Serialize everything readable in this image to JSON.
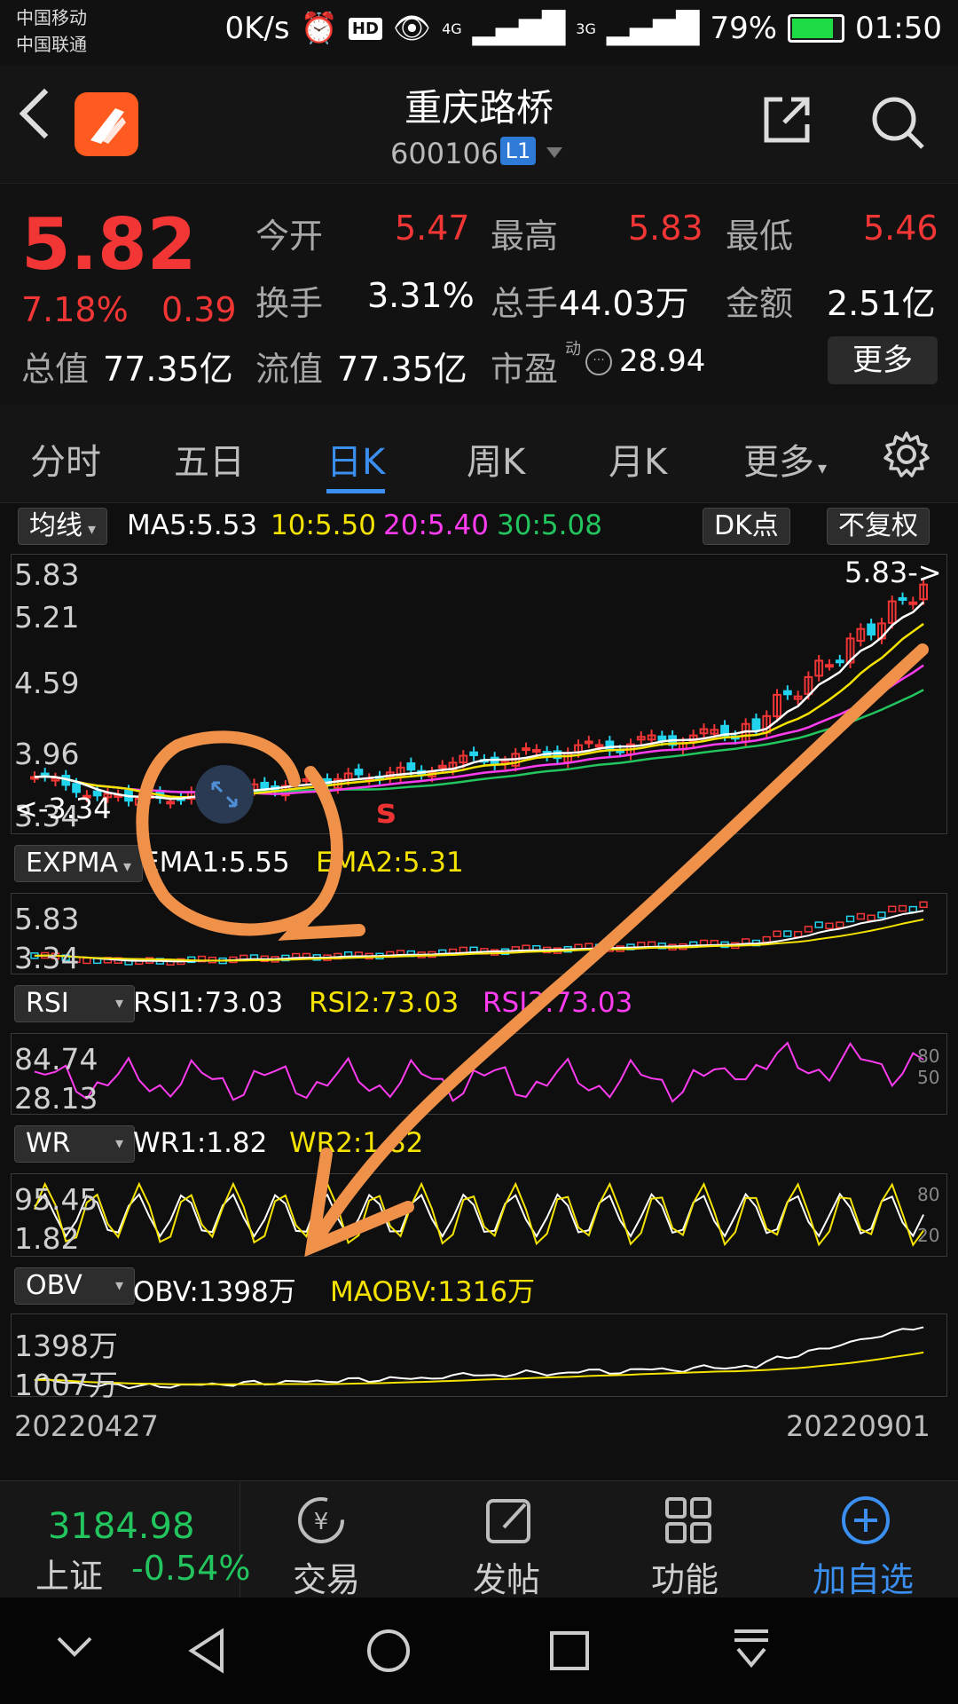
{
  "status_bar": {
    "carrier1": "中国移动",
    "carrier2": "中国联通",
    "speed": "0K/s",
    "hd": "HD",
    "net4g": "4G",
    "net3g": "3G",
    "battery": "79%",
    "time": "01:50"
  },
  "header": {
    "name": "重庆路桥",
    "code": "600106",
    "level": "L1"
  },
  "quote": {
    "price": "5.82",
    "change_pct": "7.18%",
    "change": "0.39",
    "open_label": "今开",
    "open": "5.47",
    "high_label": "最高",
    "high": "5.83",
    "low_label": "最低",
    "low": "5.46",
    "turnover_label": "换手",
    "turnover": "3.31%",
    "volume_label": "总手",
    "volume": "44.03万",
    "amount_label": "金额",
    "amount": "2.51亿",
    "total_cap_label": "总值",
    "total_cap": "77.35亿",
    "float_cap_label": "流值",
    "float_cap": "77.35亿",
    "pe_label": "市盈",
    "pe_sup": "动",
    "pe": "28.94",
    "more": "更多"
  },
  "tabs": [
    {
      "label": "分时"
    },
    {
      "label": "五日"
    },
    {
      "label": "日K"
    },
    {
      "label": "周K"
    },
    {
      "label": "月K"
    },
    {
      "label": "更多"
    }
  ],
  "main_panel": {
    "selector": "均线",
    "ma5": "MA5:5.53",
    "ma10": "10:5.50",
    "ma20": "20:5.40",
    "ma30": "30:5.08",
    "dk_button": "DK点",
    "adjust_button": "不复权",
    "y_labels": [
      "5.83",
      "5.21",
      "4.59",
      "3.96",
      "3.34"
    ],
    "high_marker": "5.83->",
    "low_marker": "<-3.34",
    "annotation": "s"
  },
  "expma_panel": {
    "selector": "EXPMA",
    "ema1": "EMA1:5.55",
    "ema2": "EMA2:5.31",
    "y_labels": [
      "5.83",
      "3.34"
    ]
  },
  "rsi_panel": {
    "selector": "RSI",
    "rsi1": "RSI1:73.03",
    "rsi2": "RSI2:73.03",
    "rsi3": "RSI3:73.03",
    "y_labels": [
      "84.74",
      "28.13"
    ],
    "right_labels": [
      "80",
      "50"
    ]
  },
  "wr_panel": {
    "selector": "WR",
    "wr1": "WR1:1.82",
    "wr2": "WR2:1.82",
    "y_labels": [
      "95.45",
      "1.82"
    ],
    "right_labels": [
      "80",
      "20"
    ]
  },
  "obv_panel": {
    "selector": "OBV",
    "obv": "OBV:1398万",
    "maobv": "MAOBV:1316万",
    "y_labels": [
      "1398万",
      "1007万"
    ]
  },
  "date_range": {
    "start": "20220427",
    "end": "20220901"
  },
  "bottom_bar": {
    "index_value": "3184.98",
    "index_name": "上证",
    "index_change": "-0.54%",
    "trade": "交易",
    "post": "发帖",
    "function": "功能",
    "add_watch": "加自选"
  },
  "colors": {
    "up": "#f23636",
    "down": "#22d3ee",
    "ma5": "#ffffff",
    "ma10": "#f4e300",
    "ma20": "#ff3cf0",
    "ma30": "#22c55e",
    "accent": "#3a8ff0",
    "annotation": "#f0914a"
  },
  "icons": [
    "back-icon",
    "app-logo-icon",
    "share-icon",
    "search-icon",
    "settings-icon",
    "expand-icon",
    "trade-icon",
    "post-icon",
    "function-icon",
    "add-icon",
    "nav-back-icon",
    "nav-home-icon",
    "nav-recent-icon",
    "nav-down-icon",
    "nav-menu-icon"
  ]
}
